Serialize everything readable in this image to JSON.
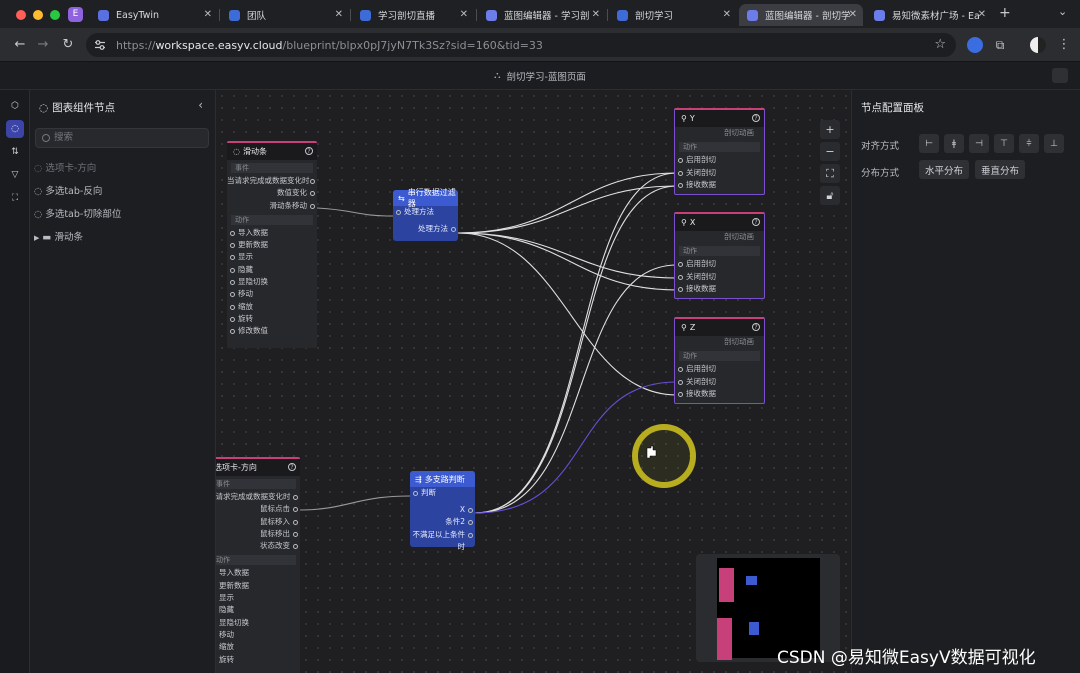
{
  "browser": {
    "tabs": [
      {
        "label": "EasyTwin"
      },
      {
        "label": "团队"
      },
      {
        "label": "学习剖切直播"
      },
      {
        "label": "蓝图编辑器 - 学习剖"
      },
      {
        "label": "剖切学习"
      },
      {
        "label": "蓝图编辑器 - 剖切学"
      },
      {
        "label": "易知微素材广场 - Ea"
      }
    ],
    "profile_letter": "E",
    "url_scheme": "https://",
    "url_host": "workspace.easyv.cloud",
    "url_path": "/blueprint/blpx0pJ7jyN7Tk3Sz?sid=160&tid=33",
    "new_tab": "+"
  },
  "app": {
    "title": "剖切学习-蓝图页面"
  },
  "left_panel": {
    "title": "图表组件节点",
    "search_placeholder": "搜索",
    "items": [
      {
        "label": "选项卡-方向"
      },
      {
        "label": "多选tab-反向"
      },
      {
        "label": "多选tab-切除部位"
      },
      {
        "label": "滑动条"
      }
    ]
  },
  "right_panel": {
    "title": "节点配置面板",
    "align_label": "对齐方式",
    "distribute_label": "分布方式",
    "distribute_buttons": [
      "水平分布",
      "垂直分布"
    ]
  },
  "nodes": {
    "slider": {
      "title": "滑动条",
      "events_label": "事件",
      "events": [
        "当请求完成或数据变化时",
        "数值变化",
        "滑动条移动"
      ],
      "actions_label": "动作",
      "actions": [
        "导入数据",
        "更新数据",
        "显示",
        "隐藏",
        "显隐切换",
        "移动",
        "缩放",
        "旋转",
        "修改数值"
      ]
    },
    "filter": {
      "title": "串行数据过滤器",
      "input": "处理方法",
      "output": "处理方法"
    },
    "switch": {
      "title": "多支路判断",
      "input": "判断",
      "outputs": [
        "X",
        "条件2",
        "不满足以上条件时"
      ]
    },
    "tab_dir": {
      "title": "选项卡-方向",
      "events_label": "事件",
      "events": [
        "当请求完成或数据变化时",
        "鼠标点击",
        "鼠标移入",
        "鼠标移出",
        "状态改变"
      ],
      "actions_label": "动作",
      "actions": [
        "导入数据",
        "更新数据",
        "显示",
        "隐藏",
        "显隐切换",
        "移动",
        "缩放",
        "旋转"
      ]
    },
    "cut_nodes": [
      {
        "title": "Y",
        "subtitle": "剖切动画",
        "actions_label": "动作",
        "actions": [
          "启用剖切",
          "关闭剖切",
          "接收数据"
        ]
      },
      {
        "title": "X",
        "subtitle": "剖切动画",
        "actions_label": "动作",
        "actions": [
          "启用剖切",
          "关闭剖切",
          "接收数据"
        ]
      },
      {
        "title": "Z",
        "subtitle": "剖切动画",
        "actions_label": "动作",
        "actions": [
          "启用剖切",
          "关闭剖切",
          "接收数据"
        ]
      }
    ]
  },
  "zoom_controls": [
    "+",
    "−"
  ],
  "watermark": "CSDN @易知微EasyV数据可视化",
  "colors": {
    "accent": "#3d5bd0",
    "node_header_pink": "#c8407a",
    "node_border_purple": "#7a4fd0",
    "link_white": "#d8d8d8",
    "link_purple": "#6a4fd8",
    "cursor_ring": "#d4c61e"
  }
}
